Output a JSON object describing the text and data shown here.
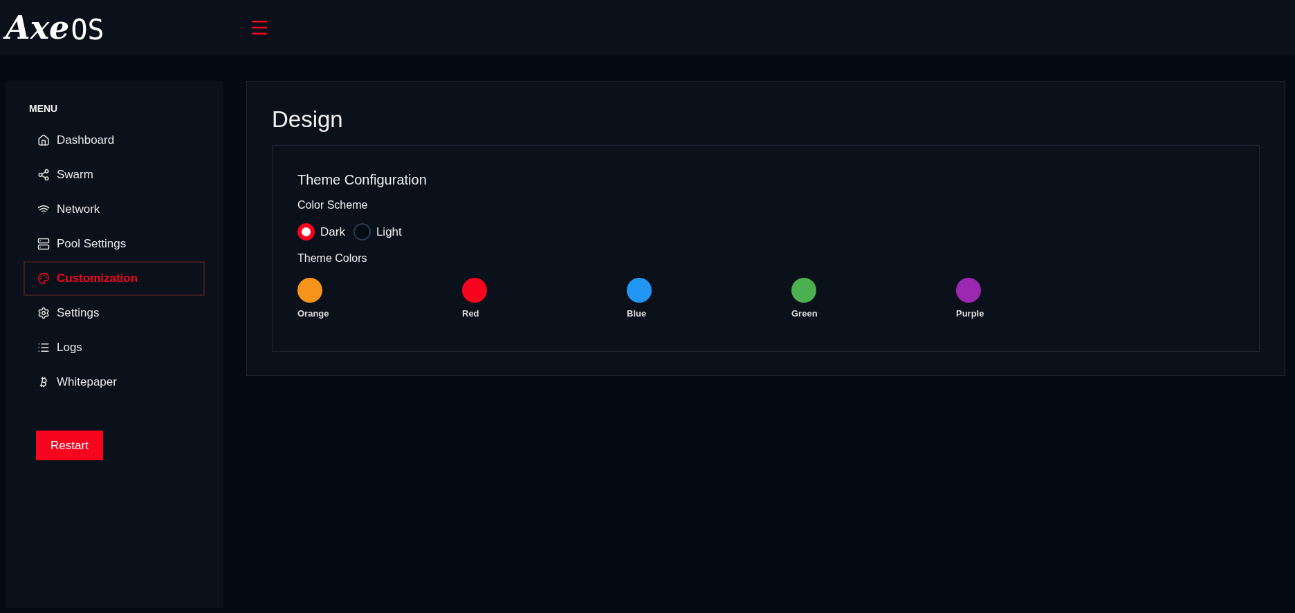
{
  "header": {
    "logo_script": "Axe",
    "logo_block": "OS"
  },
  "sidebar": {
    "heading": "MENU",
    "items": [
      {
        "label": "Dashboard",
        "selected": false
      },
      {
        "label": "Swarm",
        "selected": false
      },
      {
        "label": "Network",
        "selected": false
      },
      {
        "label": "Pool Settings",
        "selected": false
      },
      {
        "label": "Customization",
        "selected": true
      },
      {
        "label": "Settings",
        "selected": false
      },
      {
        "label": "Logs",
        "selected": false
      },
      {
        "label": "Whitepaper",
        "selected": false
      }
    ],
    "restart_button": "Restart"
  },
  "page": {
    "title": "Design",
    "section_title": "Theme Configuration",
    "color_scheme_label": "Color Scheme",
    "color_scheme_options": [
      {
        "label": "Dark",
        "selected": true
      },
      {
        "label": "Light",
        "selected": false
      }
    ],
    "theme_colors_label": "Theme Colors",
    "theme_colors": [
      {
        "label": "Orange",
        "color": "#f7931a"
      },
      {
        "label": "Red",
        "color": "#f7041e"
      },
      {
        "label": "Blue",
        "color": "#2196f3"
      },
      {
        "label": "Green",
        "color": "#4caf50"
      },
      {
        "label": "Purple",
        "color": "#9c27b0"
      }
    ]
  }
}
